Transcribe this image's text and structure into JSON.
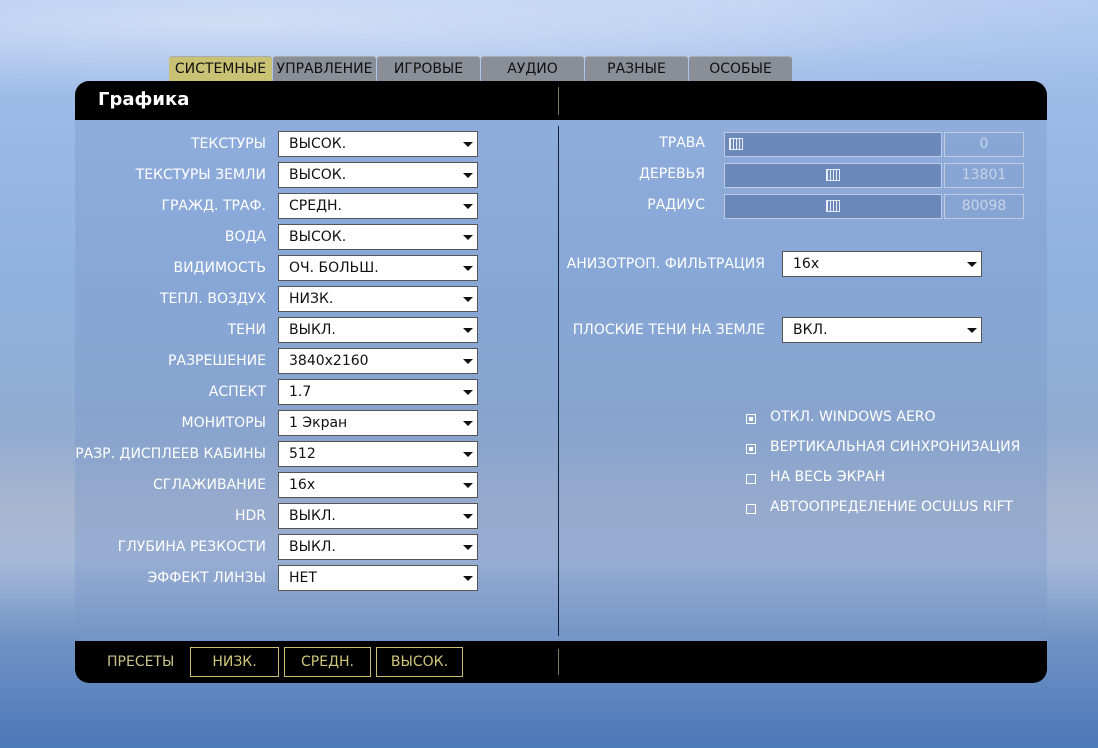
{
  "tabs": [
    "СИСТЕМНЫЕ",
    "УПРАВЛЕНИЕ",
    "ИГРОВЫЕ",
    "АУДИО",
    "РАЗНЫЕ",
    "ОСОБЫЕ"
  ],
  "active_tab": "СИСТЕМНЫЕ",
  "section_title": "Графика",
  "left_settings": [
    {
      "label": "ТЕКСТУРЫ",
      "value": "ВЫСОК."
    },
    {
      "label": "ТЕКСТУРЫ ЗЕМЛИ",
      "value": "ВЫСОК."
    },
    {
      "label": "ГРАЖД. ТРАФ.",
      "value": "СРЕДН."
    },
    {
      "label": "ВОДА",
      "value": "ВЫСОК."
    },
    {
      "label": "ВИДИМОСТЬ",
      "value": "ОЧ. БОЛЬШ."
    },
    {
      "label": "ТЕПЛ. ВОЗДУХ",
      "value": "НИЗК."
    },
    {
      "label": "ТЕНИ",
      "value": "ВЫКЛ."
    },
    {
      "label": "РАЗРЕШЕНИЕ",
      "value": "3840x2160"
    },
    {
      "label": "АСПЕКТ",
      "value": "1.7"
    },
    {
      "label": "МОНИТОРЫ",
      "value": "1 Экран"
    },
    {
      "label": "РАЗР. ДИСПЛЕЕВ КАБИНЫ",
      "value": "512"
    },
    {
      "label": "СГЛАЖИВАНИЕ",
      "value": "16x"
    },
    {
      "label": "HDR",
      "value": "ВЫКЛ."
    },
    {
      "label": "ГЛУБИНА РЕЗКОСТИ",
      "value": "ВЫКЛ."
    },
    {
      "label": "ЭФФЕКТ ЛИНЗЫ",
      "value": "НЕТ"
    }
  ],
  "sliders": [
    {
      "label": "ТРАВА",
      "value": "0",
      "level": 0.0
    },
    {
      "label": "ДЕРЕВЬЯ",
      "value": "13801",
      "level": 0.5
    },
    {
      "label": "РАДИУС",
      "value": "80098",
      "level": 0.5
    }
  ],
  "right_selects": [
    {
      "label": "АНИЗОТРОП. ФИЛЬТРАЦИЯ",
      "value": "16x"
    },
    {
      "label": "ПЛОСКИЕ ТЕНИ НА ЗЕМЛЕ",
      "value": "ВКЛ."
    }
  ],
  "checkboxes": [
    {
      "label": "ОТКЛ. WINDOWS AERO",
      "checked": true
    },
    {
      "label": "ВЕРТИКАЛЬНАЯ СИНХРОНИЗАЦИЯ",
      "checked": true
    },
    {
      "label": "НА ВЕСЬ ЭКРАН",
      "checked": false
    },
    {
      "label": "АВТООПРЕДЕЛЕНИЕ OCULUS RIFT",
      "checked": false
    }
  ],
  "presets": {
    "label": "ПРЕСЕТЫ",
    "buttons": [
      "НИЗК.",
      "СРЕДН.",
      "ВЫСОК."
    ]
  },
  "colors": {
    "active_tab": "#c9c173",
    "tab": "#8a8e97",
    "header": "#000000",
    "preset_accent": "#c8c070"
  }
}
